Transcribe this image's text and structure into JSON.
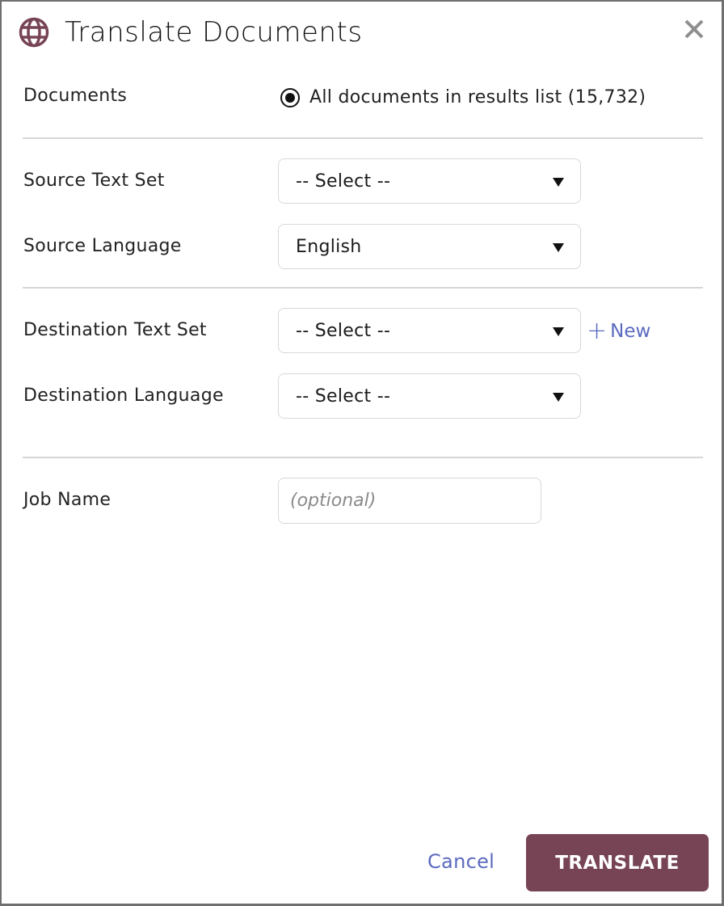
{
  "dialog": {
    "title": "Translate Documents",
    "icon": "globe-icon",
    "close_icon": "close-icon",
    "brand_color": "#774455",
    "link_color": "#5b6abf"
  },
  "documents": {
    "label": "Documents",
    "option_label": "All documents in results list (15,732)",
    "selected": true
  },
  "source_text_set": {
    "label": "Source Text Set",
    "value": "-- Select --"
  },
  "source_language": {
    "label": "Source Language",
    "value": "English"
  },
  "destination_text_set": {
    "label": "Destination Text Set",
    "value": "-- Select --",
    "new_label": "New"
  },
  "destination_language": {
    "label": "Destination Language",
    "value": "-- Select --"
  },
  "job_name": {
    "label": "Job Name",
    "value": "",
    "placeholder": "(optional)"
  },
  "footer": {
    "cancel_label": "Cancel",
    "translate_label": "TRANSLATE"
  }
}
